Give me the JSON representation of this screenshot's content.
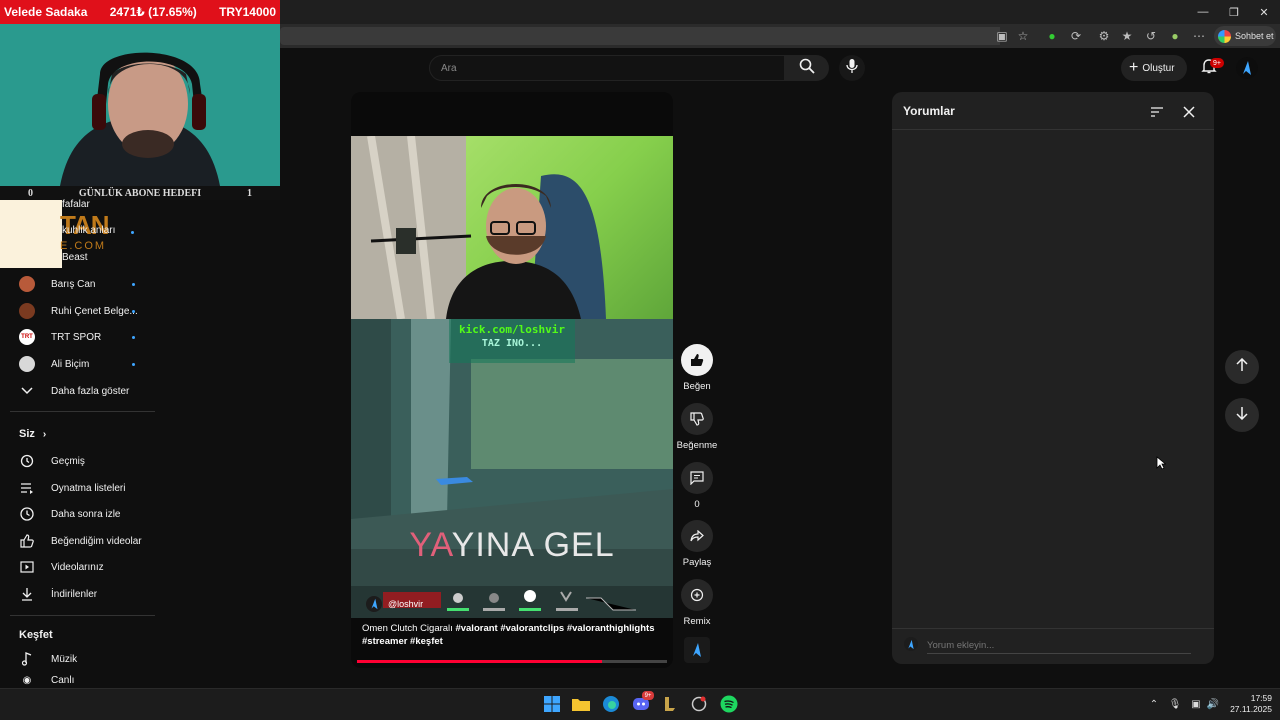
{
  "overlay": {
    "name": "Velede Sadaka",
    "change": "2471₺ (17.65%)",
    "goal_total": "TRY14000",
    "goal_label": "GÜNLÜK ABONE HEDEFI",
    "goal_current": "0",
    "goal_target": "1",
    "logo_text": "TAN",
    "logo_sub": "E.COM"
  },
  "browser": {
    "sohbet_label": "Sohbet et"
  },
  "header": {
    "search_placeholder": "Ara",
    "create_label": "Oluştur",
    "notification_count": "9+"
  },
  "sidebar": {
    "subscriptions": [
      {
        "label": "fafalar",
        "live": false
      },
      {
        "label": "kuhlik anları",
        "live": true
      },
      {
        "label": "Beast",
        "live": false
      },
      {
        "label": "Barış Can",
        "live": true,
        "avatar": "#b85a3a"
      },
      {
        "label": "Ruhi Çenet Belge...",
        "live": true,
        "avatar": "#7a3a20"
      },
      {
        "label": "TRT SPOR",
        "live": true,
        "avatar": "#ffffff"
      },
      {
        "label": "Ali Biçim",
        "live": true,
        "avatar": "#d8d8d8"
      }
    ],
    "more_label": "Daha fazla göster",
    "you_label": "Siz",
    "you_items": [
      "Geçmiş",
      "Oynatma listeleri",
      "Daha sonra izle",
      "Beğendiğim videolar",
      "Videolarınız",
      "İndirilenler"
    ],
    "explore_label": "Keşfet",
    "explore_items": [
      "Müzik",
      "Canlı"
    ]
  },
  "short": {
    "overlay_link": "kick.com/loshvir",
    "overlay_sub": "TAZ INO...",
    "banner_highlight": "YA",
    "banner_rest": "YINA GEL",
    "channel_handle": "@loshvir",
    "caption_plain": "Omen Clutch Cigaralı",
    "caption_tags": "#valorant #valorantclips #valoranthighlights #streamer #keşfet",
    "progress": 0.79
  },
  "actions": {
    "like": "Beğen",
    "dislike": "Beğenme",
    "comments_count": "0",
    "share": "Paylaş",
    "remix": "Remix"
  },
  "comments": {
    "title": "Yorumlar",
    "input_placeholder": "Yorum ekleyin..."
  },
  "taskbar": {
    "discord_badge": "9+",
    "time": "17:59",
    "date": "27.11.2025"
  }
}
